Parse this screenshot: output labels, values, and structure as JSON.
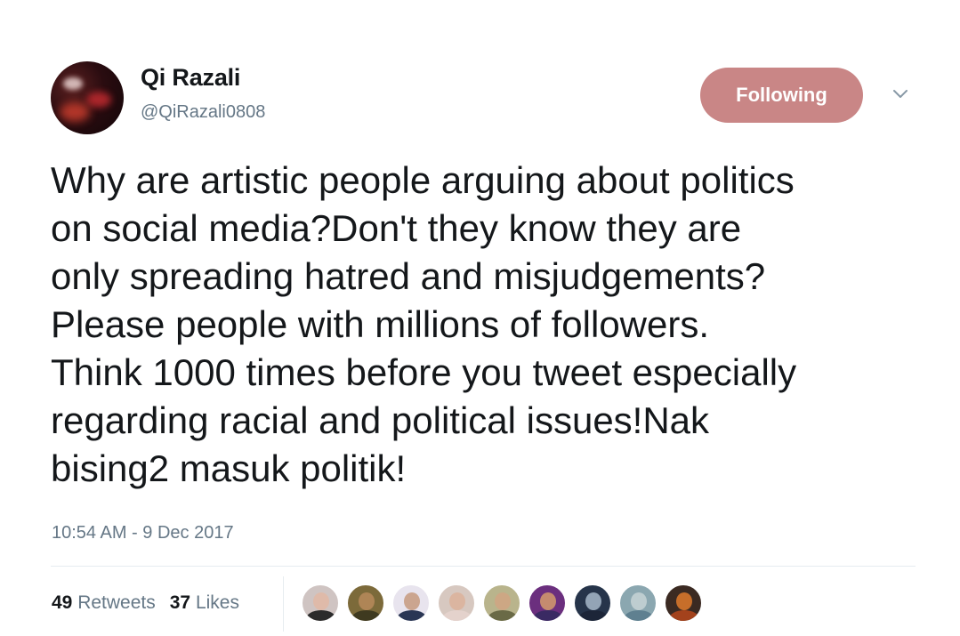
{
  "user": {
    "name": "Qi Razali",
    "handle": "@QiRazali0808"
  },
  "follow_button": {
    "label": "Following",
    "color": "#c98686"
  },
  "tweet": {
    "text": "Why are artistic people arguing about politics\non social media?Don't they know they are\nonly spreading hatred and misjudgements?\nPlease people with millions of followers.\nThink 1000 times before you tweet especially\nregarding racial and political issues!Nak\nbising2 masuk politik!",
    "timestamp": "10:54 AM - 9 Dec 2017"
  },
  "stats": {
    "retweets_count": "49",
    "retweets_label": "Retweets",
    "likes_count": "37",
    "likes_label": "Likes"
  },
  "likers": [
    {
      "bg": "#cfc4c2",
      "body": "#2b2b2b",
      "face": "#e2b9a4"
    },
    {
      "bg": "#7c6a3a",
      "body": "#3f3a20",
      "face": "#b98a5c"
    },
    {
      "bg": "#e8e4ee",
      "body": "#2a3654",
      "face": "#c69a7e"
    },
    {
      "bg": "#d7c8c0",
      "body": "#e4d2cc",
      "face": "#dcb29a"
    },
    {
      "bg": "#b9b48c",
      "body": "#6a6a46",
      "face": "#d0a583"
    },
    {
      "bg": "#6b2f7e",
      "body": "#3a2a63",
      "face": "#d59b6c"
    },
    {
      "bg": "#26344a",
      "body": "#1c2538",
      "face": "#a7b9c9"
    },
    {
      "bg": "#8ba7b0",
      "body": "#5f8090",
      "face": "#c7d4d6"
    },
    {
      "bg": "#3b2a22",
      "body": "#a3421c",
      "face": "#e07a2c"
    }
  ],
  "icons": {
    "chevron": "chevron-down-icon"
  }
}
